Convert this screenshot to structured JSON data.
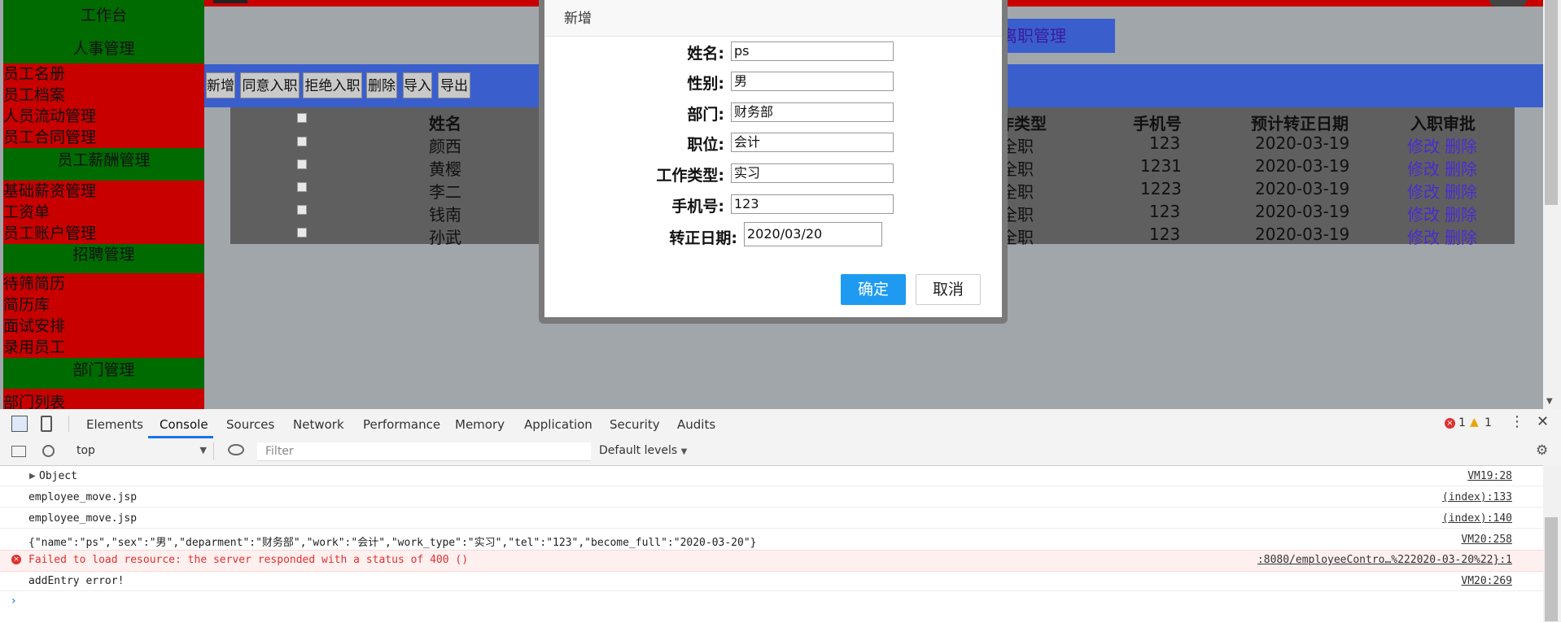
{
  "sidebar": {
    "sections": [
      {
        "title": "工作台",
        "items": []
      },
      {
        "title": "人事管理",
        "items": [
          "员工名册",
          "员工档案",
          "人员流动管理",
          "员工合同管理"
        ]
      },
      {
        "title": "员工薪酬管理",
        "items": [
          "基础薪资管理",
          "工资单",
          "员工账户管理"
        ]
      },
      {
        "title": "招聘管理",
        "items": [
          "待筛简历",
          "简历库",
          "面试安排",
          "录用员工"
        ]
      },
      {
        "title": "部门管理",
        "items": [
          "部门列表"
        ]
      }
    ]
  },
  "main": {
    "tab_resign": "离职管理",
    "toolbar": {
      "add": "新增",
      "approve": "同意入职",
      "reject": "拒绝入职",
      "delete": "删除",
      "import": "导入",
      "export": "导出"
    },
    "table": {
      "headers": {
        "name": "姓名",
        "work_type": "作类型",
        "tel": "手机号",
        "become_full": "预计转正日期",
        "review": "入职审批"
      },
      "rows": [
        {
          "name": "颜西",
          "work_type": "全职",
          "tel": "123",
          "date": "2020-03-19",
          "edit": "修改",
          "del": "删除"
        },
        {
          "name": "黄樱",
          "work_type": "全职",
          "tel": "1231",
          "date": "2020-03-19",
          "edit": "修改",
          "del": "删除"
        },
        {
          "name": "李二",
          "work_type": "全职",
          "tel": "1223",
          "date": "2020-03-19",
          "edit": "修改",
          "del": "删除"
        },
        {
          "name": "钱南",
          "work_type": "全职",
          "tel": "123",
          "date": "2020-03-19",
          "edit": "修改",
          "del": "删除"
        },
        {
          "name": "孙武",
          "work_type": "全职",
          "tel": "123",
          "date": "2020-03-19",
          "edit": "修改",
          "del": "删除"
        }
      ]
    }
  },
  "modal": {
    "title": "新增",
    "fields": {
      "name": {
        "label": "姓名:",
        "value": "ps"
      },
      "sex": {
        "label": "性别:",
        "value": "男"
      },
      "dept": {
        "label": "部门:",
        "value": "财务部"
      },
      "job": {
        "label": "职位:",
        "value": "会计"
      },
      "work_type": {
        "label": "工作类型:",
        "value": "实习"
      },
      "tel": {
        "label": "手机号:",
        "value": "123"
      },
      "become_full": {
        "label": "转正日期:",
        "value": "2020/03/20"
      }
    },
    "ok": "确定",
    "cancel": "取消"
  },
  "devtools": {
    "tabs": [
      "Elements",
      "Console",
      "Sources",
      "Network",
      "Performance",
      "Memory",
      "Application",
      "Security",
      "Audits"
    ],
    "active_tab": "Console",
    "error_count": "1",
    "warning_count": "1",
    "context": "top",
    "filter_placeholder": "Filter",
    "levels": "Default levels",
    "console": [
      {
        "text": "Object",
        "src": "VM19:28"
      },
      {
        "text": "employee_move.jsp",
        "src": "(index):133"
      },
      {
        "text": "employee_move.jsp",
        "src": "(index):140"
      },
      {
        "text": "{\"name\":\"ps\",\"sex\":\"男\",\"deparment\":\"财务部\",\"work\":\"会计\",\"work_type\":\"实习\",\"tel\":\"123\",\"become_full\":\"2020-03-20\"}",
        "src": "VM20:258"
      },
      {
        "text": "Failed to load resource: the server responded with a status of 400 ()",
        "src": ":8080/employeeContro…%222020-03-20%22}:1"
      },
      {
        "text": "addEntry error!",
        "src": "VM20:269"
      }
    ]
  }
}
